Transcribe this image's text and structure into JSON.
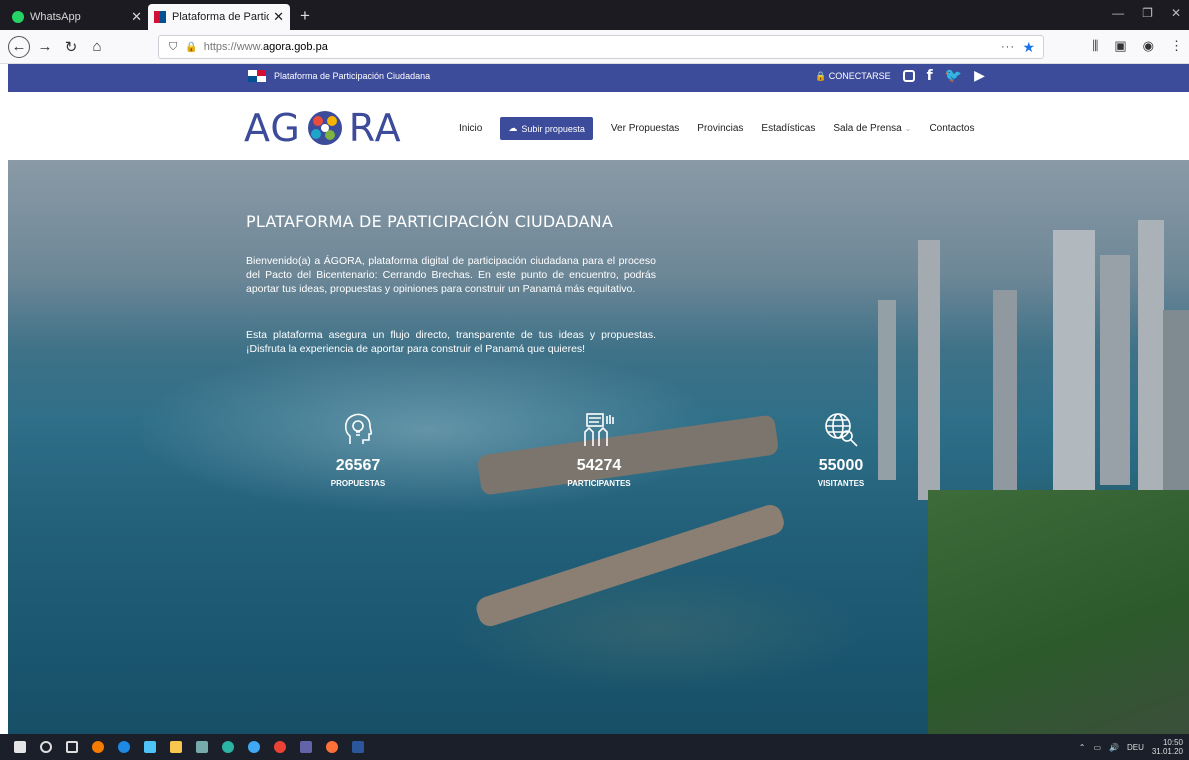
{
  "browser": {
    "tabs": [
      {
        "title": "WhatsApp",
        "active": false
      },
      {
        "title": "Plataforma de Participación Ciu",
        "active": true
      }
    ],
    "new_tab": "+",
    "url_protocol": "https://www.",
    "url_domain": "agora.gob.pa",
    "url_more": "···"
  },
  "topbar": {
    "brand": "Plataforma de Participación Ciudadana",
    "connect": "CONECTARSE",
    "social": [
      "instagram-icon",
      "facebook-icon",
      "twitter-icon",
      "youtube-icon"
    ]
  },
  "header": {
    "logo_left": "AG",
    "logo_right": "RA",
    "nav": {
      "inicio": "Inicio",
      "subir": "Subir propuesta",
      "ver": "Ver Propuestas",
      "provincias": "Provincias",
      "estadisticas": "Estadísticas",
      "prensa": "Sala de Prensa",
      "contactos": "Contactos"
    }
  },
  "hero": {
    "title": "PLATAFORMA DE PARTICIPACIÓN CIUDADANA",
    "paragraph1": "Bienvenido(a) a ÁGORA, plataforma digital de participación ciudadana para el proceso del Pacto del Bicentenario: Cerrando Brechas. En este punto de encuentro, podrás aportar tus ideas, propuestas y opiniones para construir un Panamá más equitativo.",
    "paragraph2": "Esta plataforma asegura un flujo directo, transparente de tus ideas y propuestas. ¡Disfruta la experiencia de aportar para construir el Panamá que quieres!",
    "stats": [
      {
        "value": "26567",
        "label": "PROPUESTAS",
        "icon": "lightbulb-head-icon"
      },
      {
        "value": "54274",
        "label": "PARTICIPANTES",
        "icon": "raised-hands-icon"
      },
      {
        "value": "55000",
        "label": "VISITANTES",
        "icon": "globe-search-icon"
      }
    ]
  },
  "taskbar": {
    "language": "DEU",
    "time": "10:50",
    "date": "31.01.20"
  },
  "colors": {
    "brand": "#3d4b9b",
    "tab_strip": "#1c1b22",
    "taskbar": "#1b1f2a"
  }
}
